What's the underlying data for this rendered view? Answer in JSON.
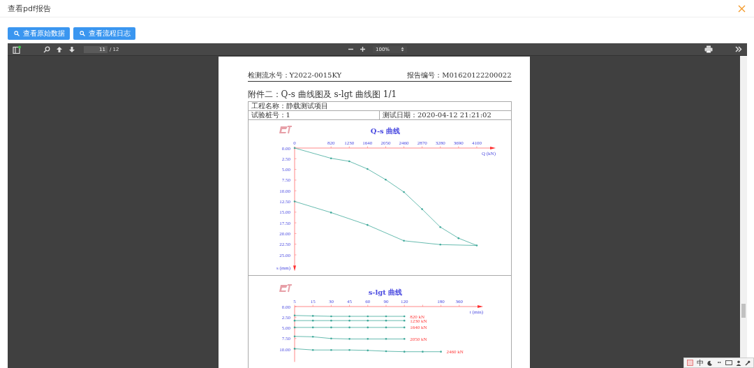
{
  "dialog": {
    "title": "查看pdf报告"
  },
  "buttons": [
    {
      "label": "查看原始数据"
    },
    {
      "label": "查看流程日志"
    }
  ],
  "pdf_viewer": {
    "toolbar": {
      "page_number": "11",
      "page_count": "/ 12",
      "zoom": "100%"
    },
    "page": {
      "serial_label": "检测流水号：Y2022-0015KY",
      "report_label": "报告编号：M01620122200022",
      "heading": "附件二：Q-s 曲线图及 s-lgt 曲线图 1/1",
      "project": "工程名称：静载测试项目",
      "pile": "试验桩号：1",
      "test_date": "测试日期：2020-04-12 21:21:02",
      "charts": [
        {
          "chart_data": {
            "type": "line",
            "title": "Q-s 曲线",
            "xlabel": "Q (kN)",
            "ylabel": "s (mm)",
            "x": [
              0,
              820,
              1230,
              1640,
              2050,
              2460,
              2870,
              3280,
              3690,
              4100
            ],
            "xlim": [
              0,
              4400
            ],
            "xticks": [
              0,
              820,
              1230,
              1640,
              2050,
              2460,
              2870,
              3280,
              3690,
              4100
            ],
            "ylim": [
              27.5,
              0
            ],
            "yticks": [
              {
                "value": 0,
                "label": "0.00"
              },
              {
                "value": 2.5,
                "label": "2.50"
              },
              {
                "value": 5,
                "label": "5.00"
              },
              {
                "value": 7.5,
                "label": "7.50"
              },
              {
                "value": 10,
                "label": "10.00"
              },
              {
                "value": 12.5,
                "label": "12.50"
              },
              {
                "value": 15,
                "label": "15.00"
              },
              {
                "value": 17.5,
                "label": "17.50"
              },
              {
                "value": 20,
                "label": "20.00"
              },
              {
                "value": 22.5,
                "label": "22.50"
              },
              {
                "value": 25,
                "label": "25.00"
              }
            ],
            "series": [
              {
                "color": "#40a99b",
                "values": [
                  0,
                  2.4,
                  3.1,
                  4.9,
                  7.4,
                  10.3,
                  14.3,
                  18.5,
                  21.1,
                  22.8
                ]
              },
              {
                "color": "#40a99b",
                "values": [
                  12.5,
                  15.1,
                  null,
                  18,
                  null,
                  21.7,
                  null,
                  22.6,
                  null,
                  22.8
                ]
              }
            ]
          }
        },
        {
          "chart_data": {
            "type": "line",
            "title": "s-lgt 曲线",
            "xlabel": "t (min)",
            "categories": [
              "5",
              "15",
              "30",
              "45",
              "60",
              "90",
              "120",
              null,
              "180",
              "360"
            ],
            "ylim": [
              13,
              0
            ],
            "yticks": [
              {
                "value": 0,
                "label": "0.00"
              },
              {
                "value": 2.5,
                "label": "2.50"
              },
              {
                "value": 5,
                "label": "5.00"
              },
              {
                "value": 7.5,
                "label": "7.50"
              },
              {
                "value": 10,
                "label": "10.00"
              }
            ],
            "series": [
              {
                "name": "820 kN",
                "color": "#40a99b",
                "values": [
                  2.1,
                  2.2,
                  2.3,
                  2.3,
                  2.3,
                  2.3,
                  2.3,
                  null,
                  null,
                  null
                ]
              },
              {
                "name": "1230 kN",
                "color": "#40a99b",
                "values": [
                  3.3,
                  3.3,
                  3.3,
                  3.3,
                  3.3,
                  3.3,
                  3.3,
                  null,
                  null,
                  null
                ]
              },
              {
                "name": "1640 kN",
                "color": "#40a99b",
                "values": [
                  4.9,
                  4.9,
                  4.9,
                  4.9,
                  4.9,
                  4.9,
                  4.9,
                  null,
                  null,
                  null
                ]
              },
              {
                "name": "2050 kN",
                "color": "#40a99b",
                "values": [
                  7.0,
                  7.1,
                  7.5,
                  7.6,
                  7.6,
                  7.6,
                  7.6,
                  null,
                  null,
                  null
                ]
              },
              {
                "name": "2460 kN",
                "color": "#40a99b",
                "values": [
                  9.9,
                  10.2,
                  10.2,
                  10.2,
                  10.3,
                  10.5,
                  10.6,
                  10.6,
                  10.6,
                  null
                ]
              }
            ]
          }
        }
      ]
    }
  },
  "ime_bar": {
    "mode": "中"
  }
}
